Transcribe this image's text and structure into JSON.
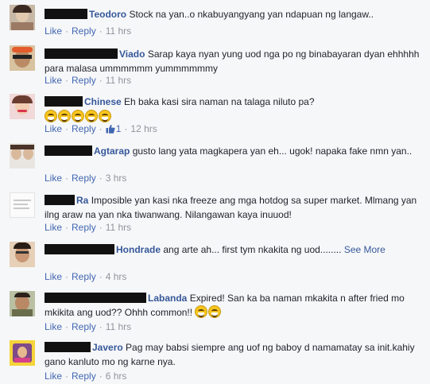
{
  "actions": {
    "like": "Like",
    "reply": "Reply",
    "separator": "·"
  },
  "comments": [
    {
      "name": "Teodoro",
      "text": "Stock na yan..o nkabuyangyang yan ndapuan ng langaw..",
      "time": "11 hrs"
    },
    {
      "name": "Viado",
      "text": "Sarap kaya nyan yung uod nga po ng binabayaran dyan ehhhhh para malasa ummmmmm yummmmmmy",
      "time": "11 hrs"
    },
    {
      "name": "Chinese",
      "text": "Eh baka kasi sira naman na talaga niluto pa?",
      "emoji": [
        "laughing-emoji",
        "laughing-emoji",
        "laughing-emoji",
        "laughing-emoji",
        "laughing-emoji"
      ],
      "like_count": "1",
      "time": "12 hrs"
    },
    {
      "name": "Agtarap",
      "text": "gusto lang yata magkapera yan eh... ugok! napaka fake nmn yan..",
      "time": "3 hrs"
    },
    {
      "name": "Ra",
      "text": "Imposible yan kasi nka freeze ang mga hotdog sa super market. Mlmang yan ilng araw na yan nka tiwanwang. Nilangawan kaya inuuod!",
      "time": "11 hrs"
    },
    {
      "name": "Hondrade",
      "text": "ang arte ah... first tym nkakita ng uod........",
      "see_more": "See More",
      "time": "4 hrs"
    },
    {
      "name": "Labanda",
      "text": "Expired! San ka ba naman mkakita n after fried mo mkikita ang uod?? Ohhh common!!",
      "emoji": [
        "laughing-emoji",
        "laughing-emoji"
      ],
      "time": "11 hrs"
    },
    {
      "name": "Javero",
      "text": "Pag may babsi siempre ang uof ng baboy d namamatay sa init.kahiy gano kanluto mo ng karne nya.",
      "time": "6 hrs"
    }
  ]
}
